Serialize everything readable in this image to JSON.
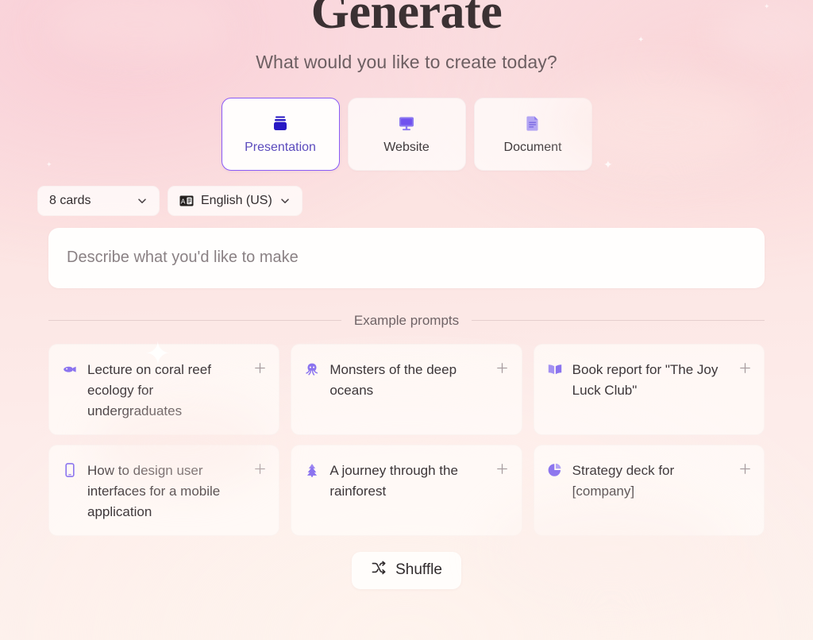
{
  "header": {
    "title": "Generate",
    "subtitle": "What would you like to create today?"
  },
  "formats": {
    "selected": "Presentation",
    "items": [
      {
        "label": "Presentation",
        "icon": "presentation-icon",
        "selected": true
      },
      {
        "label": "Website",
        "icon": "monitor-icon",
        "selected": false
      },
      {
        "label": "Document",
        "icon": "document-icon",
        "selected": false
      }
    ]
  },
  "options": {
    "cards": {
      "label": "8 cards",
      "icon": "chevron-down-icon"
    },
    "language": {
      "label": "English (US)",
      "icon": "translate-icon",
      "chevron": "chevron-down-icon"
    }
  },
  "prompt": {
    "value": "",
    "placeholder": "Describe what you'd like to make"
  },
  "examples": {
    "divider_label": "Example prompts",
    "add_icon": "plus-icon",
    "cards": [
      {
        "text": "Lecture on coral reef ecology for undergraduates",
        "icon": "fish-icon"
      },
      {
        "text": "Monsters of the deep oceans",
        "icon": "squid-icon"
      },
      {
        "text": "Book report for \"The Joy Luck Club\"",
        "icon": "open-book-icon"
      },
      {
        "text": "How to design user interfaces for a mobile application",
        "icon": "mobile-phone-icon"
      },
      {
        "text": "A journey through the rainforest",
        "icon": "evergreen-tree-icon"
      },
      {
        "text": "Strategy deck for [company]",
        "icon": "pie-chart-icon"
      }
    ]
  },
  "shuffle": {
    "label": "Shuffle",
    "icon": "shuffle-icon"
  },
  "colors": {
    "accent_purple": "#8b5cf6",
    "selected_icon": "#2718c4",
    "icon_purple": "#7c5cf5",
    "icon_purple_light": "#a391f2",
    "background_top": "#fadee2",
    "background_bottom": "#fdf1ec",
    "text_primary": "#3b3133",
    "text_secondary": "#6d5f62"
  }
}
